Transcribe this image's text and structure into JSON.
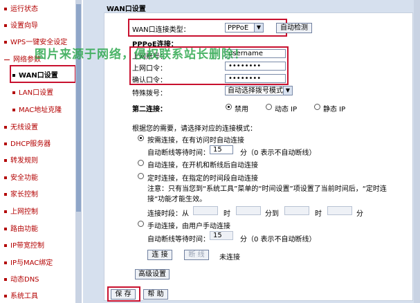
{
  "sidebar": {
    "items": [
      {
        "label": "运行状态"
      },
      {
        "label": "设置向导"
      },
      {
        "label": "WPS一键安全设定"
      },
      {
        "label": "网络参数"
      },
      {
        "label": "WAN口设置"
      },
      {
        "label": "LAN口设置"
      },
      {
        "label": "MAC地址克隆"
      },
      {
        "label": "无线设置"
      },
      {
        "label": "DHCP服务器"
      },
      {
        "label": "转发规则"
      },
      {
        "label": "安全功能"
      },
      {
        "label": "家长控制"
      },
      {
        "label": "上网控制"
      },
      {
        "label": "路由功能"
      },
      {
        "label": "IP带宽控制"
      },
      {
        "label": "IP与MAC绑定"
      },
      {
        "label": "动态DNS"
      },
      {
        "label": "系统工具"
      }
    ],
    "active": "WAN口设置"
  },
  "panel": {
    "title": "WAN口设置",
    "wan_type_label": "WAN口连接类型：",
    "wan_type_value": "PPPoE",
    "detect_button": "自动检测",
    "pppoe_section": "PPPoE连接：",
    "username_label": "上网账号：",
    "username_value": "username",
    "password_label": "上网口令：",
    "password_value": "••••••••",
    "confirm_label": "确认口令：",
    "confirm_value": "••••••••",
    "dial_label": "特殊拨号：",
    "dial_value": "自动选择拨号模式",
    "second_label": "第二连接：",
    "second_options": [
      "禁用",
      "动态 IP",
      "静态 IP"
    ],
    "mode_prompt": "根据您的需要，请选择对应的连接模式：",
    "mode_demand": "按需连接，在有访问时自动连接",
    "idle_label_1": "自动断线等待时间：",
    "idle_value_1": "15",
    "idle_unit_1": "分（0 表示不自动断线）",
    "mode_auto": "自动连接，在开机和断线后自动连接",
    "mode_timed": "定时连接，在指定的时间段自动连接",
    "timed_note": "注意：只有当您到“系统工具”菜单的“时间设置”项设置了当前时间后，“定时连接”功能才能生效。",
    "period_from": "连接时段：从",
    "period_h": "时",
    "period_m_to": "分到",
    "period_h2": "时",
    "period_m": "分",
    "mode_manual": "手动连接，由用户手动连接",
    "idle_label_2": "自动断线等待时间：",
    "idle_value_2": "15",
    "idle_unit_2": "分（0 表示不自动断线）",
    "connect_button": "连 接",
    "disconnect_button": "断 线",
    "status_text": "未连接",
    "advanced_button": "高级设置",
    "save_button": "保 存",
    "help_button": "帮 助"
  },
  "watermark": "图片来源于网络，侵权联系站长删除！",
  "colors": {
    "highlight": "#c8102e",
    "nav_text": "#b30000",
    "watermark": "#2da84e",
    "panel_bg": "#d6e0ee"
  }
}
